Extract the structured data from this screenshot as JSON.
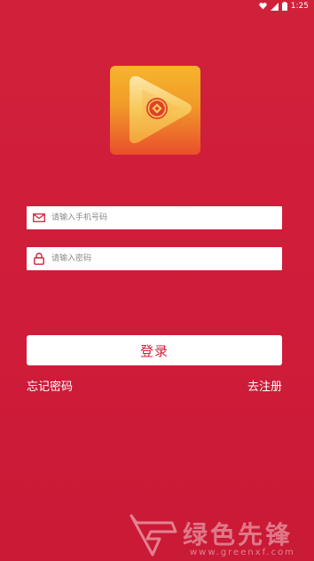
{
  "status_bar": {
    "time": "1:25",
    "icons": [
      "heart-icon",
      "signal-icon",
      "battery-icon"
    ]
  },
  "logo": {
    "icon": "play-coin-logo"
  },
  "form": {
    "phone": {
      "icon": "mail-icon",
      "placeholder": "请输入手机号码",
      "value": ""
    },
    "password": {
      "icon": "lock-icon",
      "placeholder": "请输入密码",
      "value": ""
    },
    "login_label": "登录",
    "forgot_label": "忘记密码",
    "register_label": "去注册"
  },
  "watermark": {
    "text": "绿色先锋",
    "url": "www.greenxf.com"
  },
  "colors": {
    "background": "#d0213a",
    "accent_text": "#d0213a",
    "logo_top": "#f7b52b",
    "logo_bottom": "#ea4e2b"
  }
}
